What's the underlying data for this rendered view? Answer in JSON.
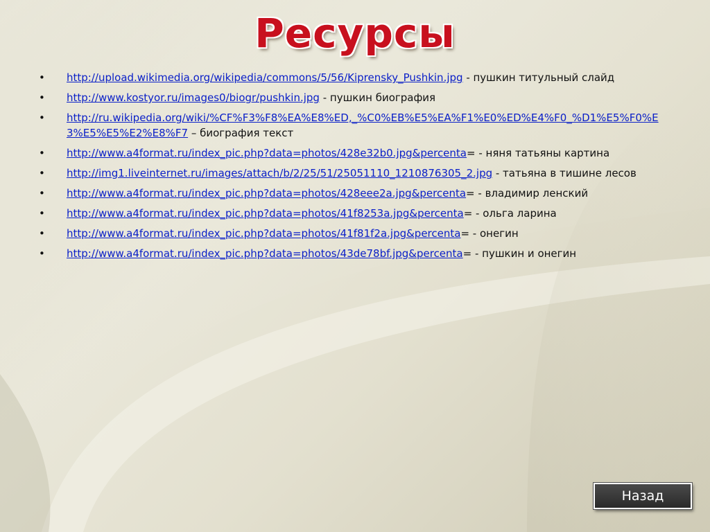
{
  "slide": {
    "title": "Ресурсы",
    "items": [
      {
        "link": "http://upload.wikimedia.org/wikipedia/commons/5/56/Kiprensky_Pushkin.jpg",
        "text": " - пушкин титульный слайд"
      },
      {
        "link": "http://www.kostyor.ru/images0/biogr/pushkin.jpg",
        "text": " - пушкин биография"
      },
      {
        "link": "http://ru.wikipedia.org/wiki/%CF%F3%F8%EA%E8%ED,_%C0%EB%E5%EA%F1%E0%ED%E4%F0_%D1%E5%F0%E3%E5%E5%E2%E8%F7",
        "text": " – биография текст"
      },
      {
        "link": "http://www.a4format.ru/index_pic.php?data=photos/428e32b0.jpg&percenta",
        "text": "= - няня татьяны картина"
      },
      {
        "link": "http://img1.liveinternet.ru/images/attach/b/2/25/51/25051110_1210876305_2.jpg",
        "text": " - татьяна в тишине лесов"
      },
      {
        "link": "http://www.a4format.ru/index_pic.php?data=photos/428eee2a.jpg&percenta",
        "text": "= - владимир ленский"
      },
      {
        "link": "http://www.a4format.ru/index_pic.php?data=photos/41f8253a.jpg&percenta",
        "text": "= - ольга ларина"
      },
      {
        "link": "http://www.a4format.ru/index_pic.php?data=photos/41f81f2a.jpg&percenta",
        "text": "= - онегин"
      },
      {
        "link": "http://www.a4format.ru/index_pic.php?data=photos/43de78bf.jpg&percenta",
        "text": "= - пушкин и онегин"
      }
    ],
    "bullet": "•",
    "back_button_label": "Назад"
  }
}
